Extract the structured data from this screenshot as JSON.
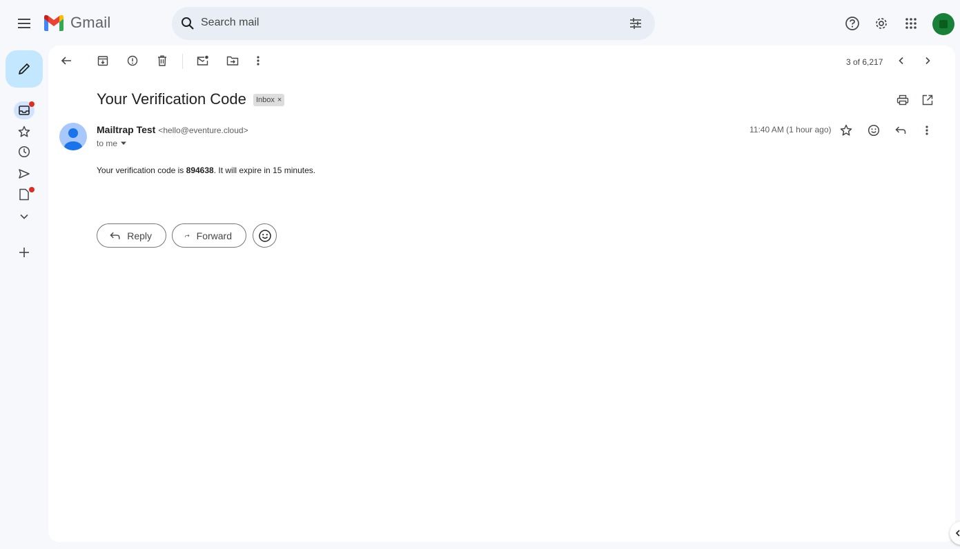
{
  "app": {
    "name": "Gmail"
  },
  "search": {
    "placeholder": "Search mail"
  },
  "toolbar": {
    "icons": [
      "back-arrow-icon",
      "archive-icon",
      "report-spam-icon",
      "delete-icon",
      "mark-unread-icon",
      "move-to-icon",
      "more-vert-icon"
    ],
    "count": "3 of 6,217"
  },
  "message": {
    "subject": "Your Verification Code",
    "label": "Inbox",
    "label_remove": "×",
    "sender_name": "Mailtrap Test",
    "sender_email": "<hello@eventure.cloud>",
    "recipient": "to me",
    "time": "11:40 AM (1 hour ago)",
    "body_before": "Your verification code is ",
    "code": "894638",
    "body_after": ". It will expire in 15 minutes."
  },
  "actions": {
    "reply": "Reply",
    "forward": "Forward"
  },
  "colors": {
    "background": "#f6f8fc",
    "compose": "#c2e7ff",
    "search": "#e9eef6",
    "notification_dot": "#d93025",
    "account_avatar": "#188038",
    "sender_avatar": "#a8c7fa"
  }
}
